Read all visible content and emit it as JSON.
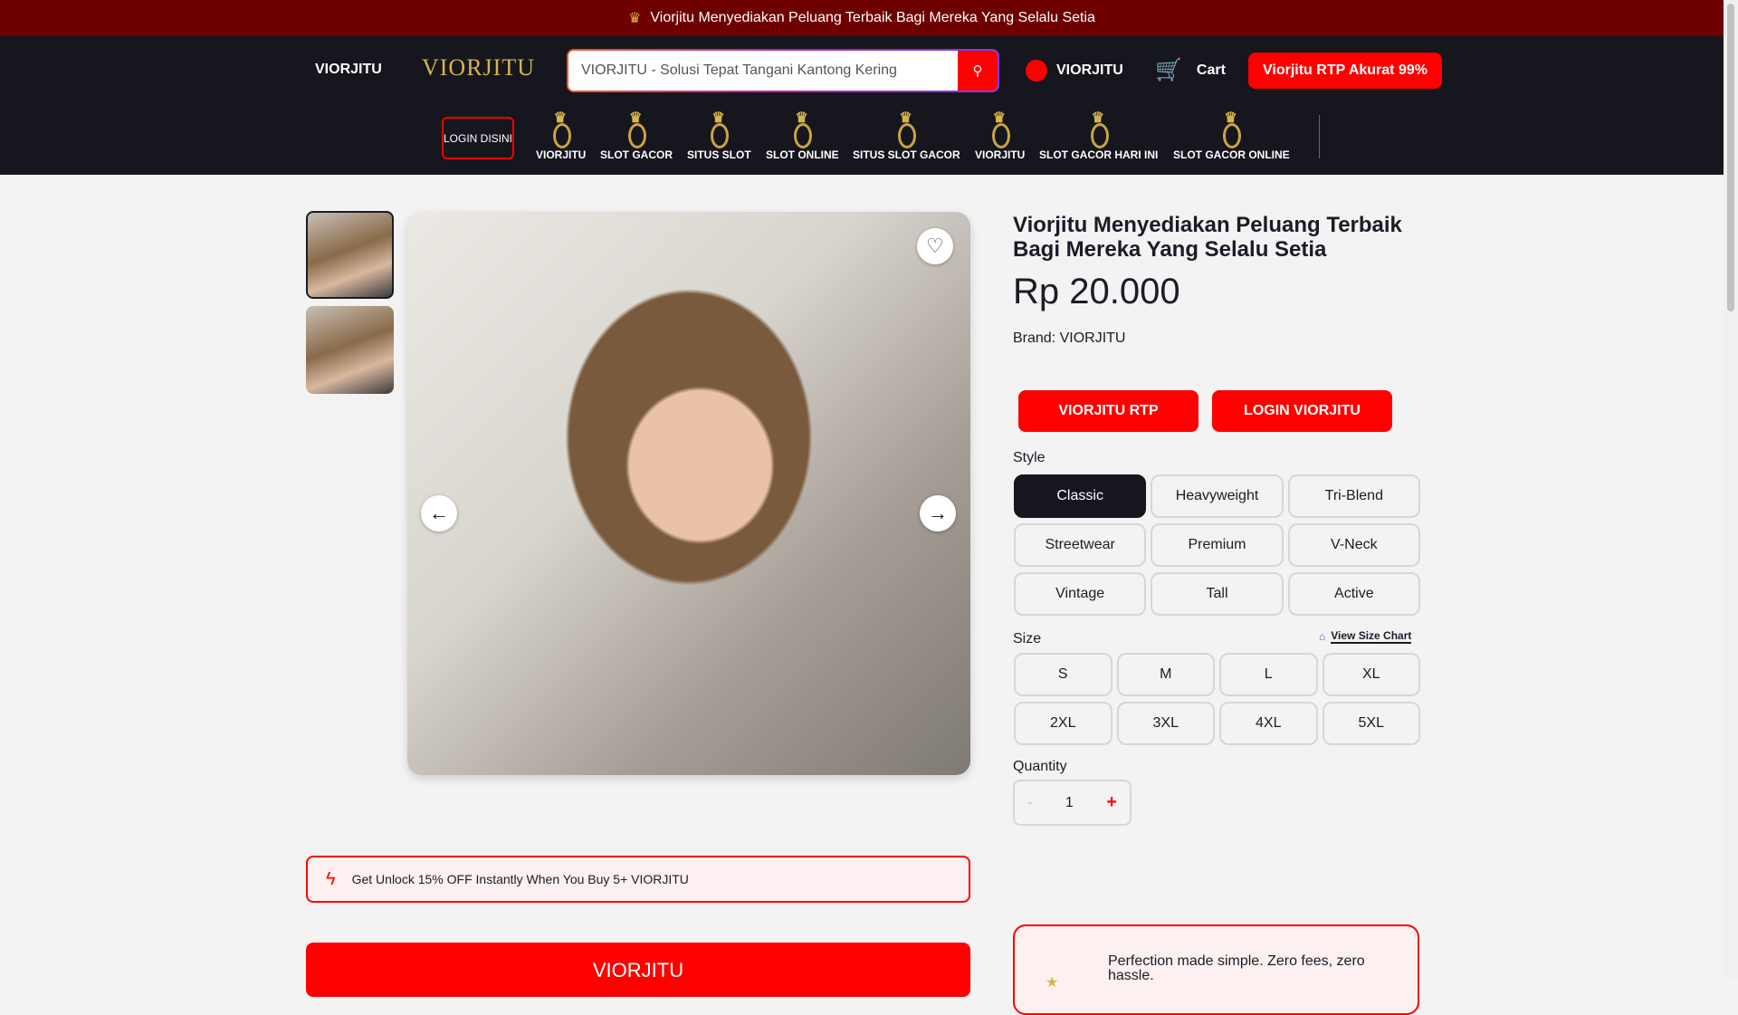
{
  "announcement": "Viorjitu Menyediakan Peluang Terbaik Bagi Mereka Yang Selalu Setia",
  "header": {
    "site_name": "VIORJITU",
    "logo_text": "VIORJITU",
    "search_value": "VIORJITU - Solusi Tepat Tangani Kantong Kering",
    "account_label": "VIORJITU",
    "cart_label": "Cart",
    "rtp_button": "Viorjitu RTP Akurat 99%"
  },
  "nav": {
    "login": "LOGIN DISINI",
    "items": [
      "VIORJITU",
      "SLOT GACOR",
      "SITUS SLOT",
      "SLOT ONLINE",
      "SITUS SLOT GACOR",
      "VIORJITU",
      "SLOT GACOR HARI INI",
      "SLOT GACOR ONLINE"
    ]
  },
  "product": {
    "title": "Viorjitu Menyediakan Peluang Terbaik Bagi Mereka Yang Selalu Setia",
    "price": "Rp 20.000",
    "brand": "Brand: VIORJITU",
    "buttons": [
      "VIORJITU RTP",
      "LOGIN VIORJITU"
    ],
    "style_label": "Style",
    "styles": [
      "Classic",
      "Heavyweight",
      "Tri-Blend",
      "Streetwear",
      "Premium",
      "V-Neck",
      "Vintage",
      "Tall",
      "Active"
    ],
    "selected_style": "Classic",
    "size_label": "Size",
    "size_chart": "View Size Chart",
    "sizes": [
      "S",
      "M",
      "L",
      "XL",
      "2XL",
      "3XL",
      "4XL",
      "5XL"
    ],
    "quantity_label": "Quantity",
    "quantity": "1",
    "minus": "-",
    "plus": "+"
  },
  "promo": "Get Unlock 15% OFF Instantly When You Buy 5+ VIORJITU",
  "bottom_button": "VIORJITU",
  "card_text": "Perfection made simple. Zero fees, zero hassle."
}
